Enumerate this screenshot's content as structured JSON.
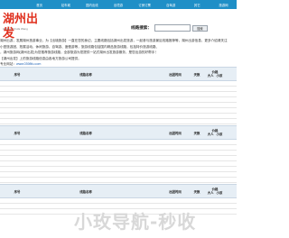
{
  "nav": [
    "",
    "首页",
    "站车城",
    "国内出线",
    "出境游",
    "订房订票",
    "自驾游",
    "其它",
    "旅游网"
  ],
  "logo": {
    "zh": "湖州出发",
    "en": "Huzhou Chufa Wang"
  },
  "search": {
    "label": "线路搜索：",
    "placeholder": "",
    "button": "搜索"
  },
  "intro": {
    "lines": [
      "湖州出游，发展湖州旅游事业，为【出境旅游】一直在您的身边，主要线路包括湖州出发旅游，一起参与旅游景区线路推荐等，湖州出游信息，更多介绍请关注",
      "小型旅游团、拓展活动、休闲旅游、自驾游、度假游等，旅游线路包括国内精品旅游线路，包括特价旅游线路、",
      "，湖州旅游网(湖州出发)为您推荐旅游线路，全部旅游为您提供一站式湖州出发旅游服务，是您出游的好帮手！",
      "【湖州出发】上的旅游线路信息由各地方旅游公司提供。"
    ],
    "url_prefix": "专业网站：",
    "url": "www.0398fu.com"
  },
  "tables": [
    {
      "headers": {
        "index": "序号",
        "name": "线路名称",
        "date": "出团时间",
        "days": "天数",
        "price_label": "价格",
        "adult": "大人",
        "child": "小孩"
      },
      "row_count": 8
    },
    {
      "headers": {
        "index": "序号",
        "name": "线路名称",
        "date": "出团时间",
        "days": "天数",
        "price_label": "价格",
        "adult": "大人",
        "child": "小孩"
      },
      "row_count": 8
    },
    {
      "headers": {
        "index": "序号",
        "name": "线路名称",
        "date": "出团时间",
        "days": "天数",
        "price_label": "价格",
        "adult": "大人",
        "child": "小孩"
      },
      "row_count": 3
    }
  ],
  "watermark": "小玫导航-秒收"
}
